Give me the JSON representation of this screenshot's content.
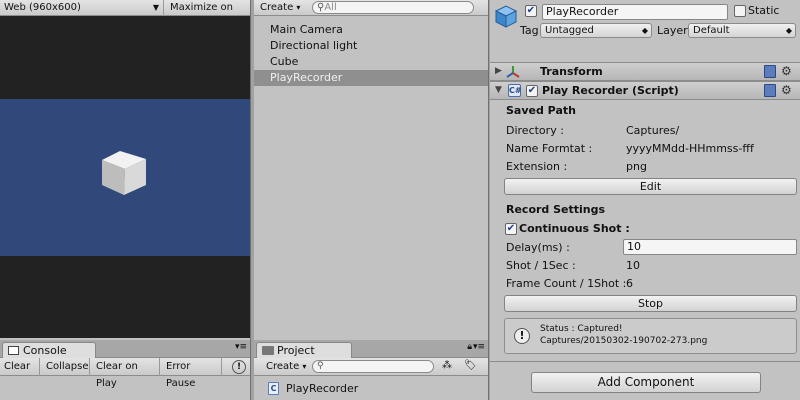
{
  "game": {
    "resolution_label": "Web (960x600)",
    "maximize_label": "Maximize on Play"
  },
  "console": {
    "tab_label": "Console",
    "buttons": [
      "Clear",
      "Collapse",
      "Clear on Play",
      "Error Pause"
    ]
  },
  "hierarchy": {
    "create_label": "Create",
    "search_placeholder": "All",
    "items": [
      {
        "label": "Main Camera"
      },
      {
        "label": "Directional light"
      },
      {
        "label": "Cube"
      },
      {
        "label": "PlayRecorder",
        "selected": true
      }
    ]
  },
  "project": {
    "tab_label": "Project",
    "create_label": "Create",
    "items": [
      {
        "label": "PlayRecorder"
      }
    ]
  },
  "inspector": {
    "object_name": "PlayRecorder",
    "static_label": "Static",
    "tag_label": "Tag",
    "tag_value": "Untagged",
    "layer_label": "Layer",
    "layer_value": "Default",
    "transform_label": "Transform",
    "script_label": "Play Recorder (Script)",
    "saved_path_title": "Saved Path",
    "directory_label": "Directory :",
    "directory_value": "Captures/",
    "name_format_label": "Name Formtat :",
    "name_format_value": "yyyyMMdd-HHmmss-fff",
    "extension_label": "Extension :",
    "extension_value": "png",
    "edit_button": "Edit",
    "record_settings_title": "Record Settings",
    "continuous_shot_label": "Continuous Shot :",
    "delay_label": "Delay(ms) :",
    "delay_value": "10",
    "shot_per_sec_label": "Shot / 1Sec :",
    "shot_per_sec_value": "10",
    "frame_count_label": "Frame Count / 1Shot :",
    "frame_count_value": "6",
    "stop_button": "Stop",
    "status_line1": "Status : Captured!",
    "status_line2": "Captures/20150302-190702-273.png",
    "add_component_button": "Add Component"
  },
  "colors": {
    "sky": "#31497a",
    "selection": "#8f8f8f",
    "check": "#1b3f8e"
  }
}
